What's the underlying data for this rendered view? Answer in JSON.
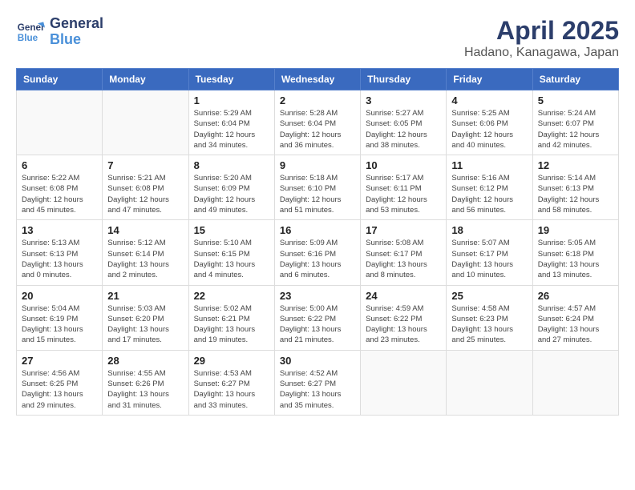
{
  "header": {
    "logo_line1": "General",
    "logo_line2": "Blue",
    "month": "April 2025",
    "location": "Hadano, Kanagawa, Japan"
  },
  "weekdays": [
    "Sunday",
    "Monday",
    "Tuesday",
    "Wednesday",
    "Thursday",
    "Friday",
    "Saturday"
  ],
  "weeks": [
    [
      {
        "day": "",
        "info": ""
      },
      {
        "day": "",
        "info": ""
      },
      {
        "day": "1",
        "info": "Sunrise: 5:29 AM\nSunset: 6:04 PM\nDaylight: 12 hours\nand 34 minutes."
      },
      {
        "day": "2",
        "info": "Sunrise: 5:28 AM\nSunset: 6:04 PM\nDaylight: 12 hours\nand 36 minutes."
      },
      {
        "day": "3",
        "info": "Sunrise: 5:27 AM\nSunset: 6:05 PM\nDaylight: 12 hours\nand 38 minutes."
      },
      {
        "day": "4",
        "info": "Sunrise: 5:25 AM\nSunset: 6:06 PM\nDaylight: 12 hours\nand 40 minutes."
      },
      {
        "day": "5",
        "info": "Sunrise: 5:24 AM\nSunset: 6:07 PM\nDaylight: 12 hours\nand 42 minutes."
      }
    ],
    [
      {
        "day": "6",
        "info": "Sunrise: 5:22 AM\nSunset: 6:08 PM\nDaylight: 12 hours\nand 45 minutes."
      },
      {
        "day": "7",
        "info": "Sunrise: 5:21 AM\nSunset: 6:08 PM\nDaylight: 12 hours\nand 47 minutes."
      },
      {
        "day": "8",
        "info": "Sunrise: 5:20 AM\nSunset: 6:09 PM\nDaylight: 12 hours\nand 49 minutes."
      },
      {
        "day": "9",
        "info": "Sunrise: 5:18 AM\nSunset: 6:10 PM\nDaylight: 12 hours\nand 51 minutes."
      },
      {
        "day": "10",
        "info": "Sunrise: 5:17 AM\nSunset: 6:11 PM\nDaylight: 12 hours\nand 53 minutes."
      },
      {
        "day": "11",
        "info": "Sunrise: 5:16 AM\nSunset: 6:12 PM\nDaylight: 12 hours\nand 56 minutes."
      },
      {
        "day": "12",
        "info": "Sunrise: 5:14 AM\nSunset: 6:13 PM\nDaylight: 12 hours\nand 58 minutes."
      }
    ],
    [
      {
        "day": "13",
        "info": "Sunrise: 5:13 AM\nSunset: 6:13 PM\nDaylight: 13 hours\nand 0 minutes."
      },
      {
        "day": "14",
        "info": "Sunrise: 5:12 AM\nSunset: 6:14 PM\nDaylight: 13 hours\nand 2 minutes."
      },
      {
        "day": "15",
        "info": "Sunrise: 5:10 AM\nSunset: 6:15 PM\nDaylight: 13 hours\nand 4 minutes."
      },
      {
        "day": "16",
        "info": "Sunrise: 5:09 AM\nSunset: 6:16 PM\nDaylight: 13 hours\nand 6 minutes."
      },
      {
        "day": "17",
        "info": "Sunrise: 5:08 AM\nSunset: 6:17 PM\nDaylight: 13 hours\nand 8 minutes."
      },
      {
        "day": "18",
        "info": "Sunrise: 5:07 AM\nSunset: 6:17 PM\nDaylight: 13 hours\nand 10 minutes."
      },
      {
        "day": "19",
        "info": "Sunrise: 5:05 AM\nSunset: 6:18 PM\nDaylight: 13 hours\nand 13 minutes."
      }
    ],
    [
      {
        "day": "20",
        "info": "Sunrise: 5:04 AM\nSunset: 6:19 PM\nDaylight: 13 hours\nand 15 minutes."
      },
      {
        "day": "21",
        "info": "Sunrise: 5:03 AM\nSunset: 6:20 PM\nDaylight: 13 hours\nand 17 minutes."
      },
      {
        "day": "22",
        "info": "Sunrise: 5:02 AM\nSunset: 6:21 PM\nDaylight: 13 hours\nand 19 minutes."
      },
      {
        "day": "23",
        "info": "Sunrise: 5:00 AM\nSunset: 6:22 PM\nDaylight: 13 hours\nand 21 minutes."
      },
      {
        "day": "24",
        "info": "Sunrise: 4:59 AM\nSunset: 6:22 PM\nDaylight: 13 hours\nand 23 minutes."
      },
      {
        "day": "25",
        "info": "Sunrise: 4:58 AM\nSunset: 6:23 PM\nDaylight: 13 hours\nand 25 minutes."
      },
      {
        "day": "26",
        "info": "Sunrise: 4:57 AM\nSunset: 6:24 PM\nDaylight: 13 hours\nand 27 minutes."
      }
    ],
    [
      {
        "day": "27",
        "info": "Sunrise: 4:56 AM\nSunset: 6:25 PM\nDaylight: 13 hours\nand 29 minutes."
      },
      {
        "day": "28",
        "info": "Sunrise: 4:55 AM\nSunset: 6:26 PM\nDaylight: 13 hours\nand 31 minutes."
      },
      {
        "day": "29",
        "info": "Sunrise: 4:53 AM\nSunset: 6:27 PM\nDaylight: 13 hours\nand 33 minutes."
      },
      {
        "day": "30",
        "info": "Sunrise: 4:52 AM\nSunset: 6:27 PM\nDaylight: 13 hours\nand 35 minutes."
      },
      {
        "day": "",
        "info": ""
      },
      {
        "day": "",
        "info": ""
      },
      {
        "day": "",
        "info": ""
      }
    ]
  ]
}
